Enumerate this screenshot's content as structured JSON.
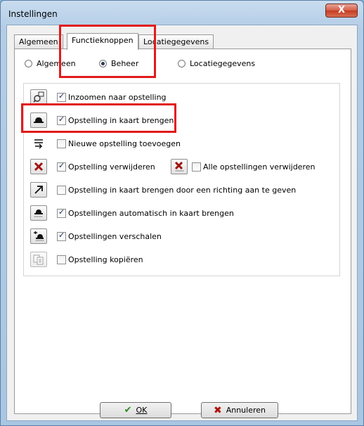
{
  "window": {
    "title": "Instellingen",
    "close_glyph": "X"
  },
  "tabs": [
    {
      "label": "Algemeen",
      "active": false
    },
    {
      "label": "Functieknoppen",
      "active": true
    },
    {
      "label": "Locatiegegevens",
      "active": false
    }
  ],
  "radios": [
    {
      "label": "Algemeen",
      "checked": false
    },
    {
      "label": "Beheer",
      "checked": true
    },
    {
      "label": "Locatiegegevens",
      "checked": false
    }
  ],
  "functions": [
    {
      "label": "Inzoomen naar opstelling",
      "checked": true,
      "icon": "zoom-to-icon"
    },
    {
      "label": "Opstelling in kaart brengen",
      "checked": true,
      "icon": "map-object-icon"
    },
    {
      "label": "Nieuwe opstelling toevoegen",
      "checked": false,
      "icon": "add-object-icon"
    },
    {
      "label": "Opstelling verwijderen",
      "checked": true,
      "icon": "delete-icon"
    },
    {
      "label": "Alle opstellingen verwijderen",
      "checked": false,
      "icon": "delete-all-icon"
    },
    {
      "label": "Opstelling in kaart brengen door een richting aan te geven",
      "checked": false,
      "icon": "direction-arrow-icon"
    },
    {
      "label": "Opstellingen automatisch in kaart brengen",
      "checked": true,
      "icon": "auto-map-icon"
    },
    {
      "label": "Opstellingen verschalen",
      "checked": true,
      "icon": "scale-icon"
    },
    {
      "label": "Opstelling kopiëren",
      "checked": false,
      "icon": "copy-icon"
    }
  ],
  "buttons": {
    "ok": "OK",
    "cancel": "Annuleren"
  },
  "colors": {
    "highlight": "#e21a1a",
    "accent": "#1d2f5a"
  }
}
